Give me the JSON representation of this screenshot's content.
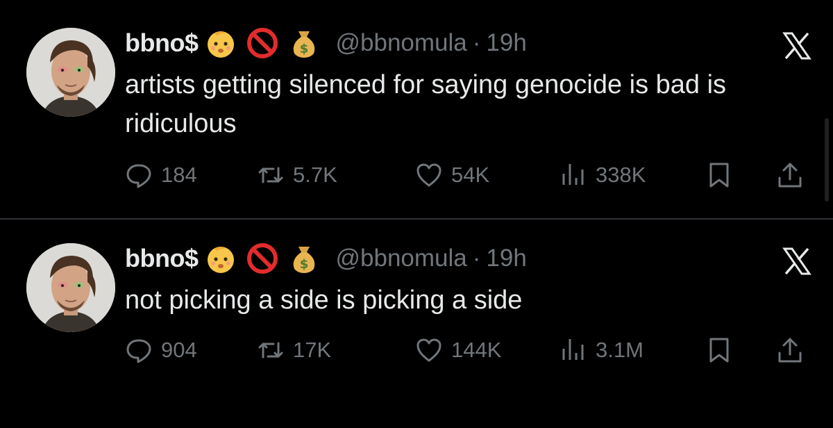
{
  "tweets": [
    {
      "display_name": "bbno$",
      "badges": [
        "baby-emoji",
        "no-entry-emoji",
        "money-bag-emoji"
      ],
      "handle": "@bbnomula",
      "separator": "·",
      "time": "19h",
      "text": "artists getting silenced for saying genocide is bad is ridiculous",
      "replies": "184",
      "reposts": "5.7K",
      "likes": "54K",
      "views": "338K"
    },
    {
      "display_name": "bbno$",
      "badges": [
        "baby-emoji",
        "no-entry-emoji",
        "money-bag-emoji"
      ],
      "handle": "@bbnomula",
      "separator": "·",
      "time": "19h",
      "text": "not picking a side is picking a side",
      "replies": "904",
      "reposts": "17K",
      "likes": "144K",
      "views": "3.1M"
    }
  ],
  "colors": {
    "background": "#000000",
    "text": "#e7e9ea",
    "muted": "#71767b",
    "divider": "#2f3336"
  },
  "icons": [
    "reply-icon",
    "repost-icon",
    "like-icon",
    "views-icon",
    "bookmark-icon",
    "share-icon",
    "x-logo-icon"
  ]
}
